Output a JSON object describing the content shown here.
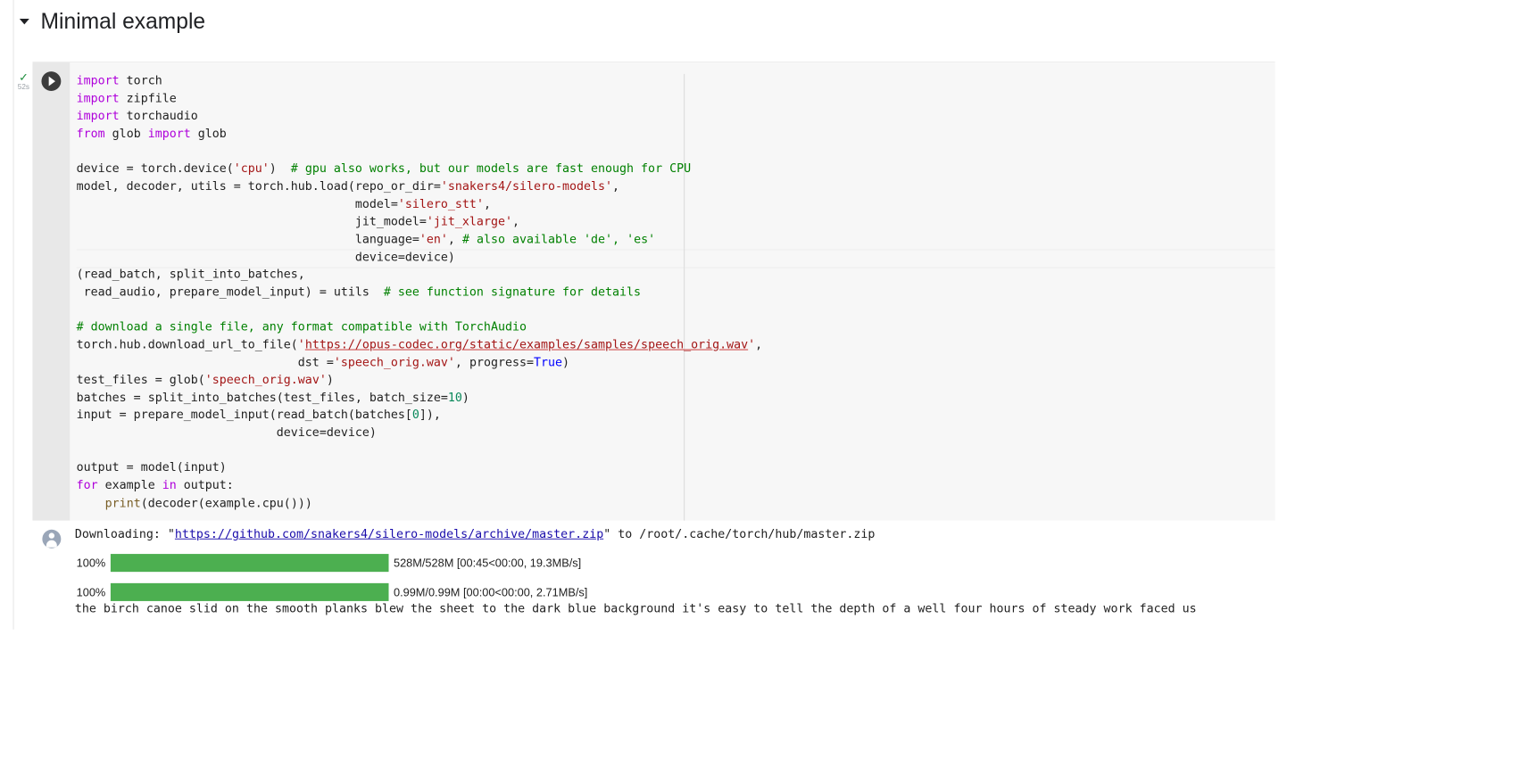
{
  "section": {
    "title": "Minimal example"
  },
  "cell": {
    "status_check": "✓",
    "exec_time": "52s",
    "code_lines": [
      "import torch",
      "import zipfile",
      "import torchaudio",
      "from glob import glob",
      "",
      "device = torch.device('cpu')  # gpu also works, but our models are fast enough for CPU",
      "model, decoder, utils = torch.hub.load(repo_or_dir='snakers4/silero-models',",
      "                                       model='silero_stt',",
      "                                       jit_model='jit_xlarge',",
      "                                       language='en', # also available 'de', 'es'",
      "                                       device=device)",
      "(read_batch, split_into_batches,",
      " read_audio, prepare_model_input) = utils  # see function signature for details",
      "",
      "# download a single file, any format compatible with TorchAudio",
      "torch.hub.download_url_to_file('https://opus-codec.org/static/examples/samples/speech_orig.wav',",
      "                               dst ='speech_orig.wav', progress=True)",
      "test_files = glob('speech_orig.wav')",
      "batches = split_into_batches(test_files, batch_size=10)",
      "input = prepare_model_input(read_batch(batches[0]),",
      "                            device=device)",
      "",
      "output = model(input)",
      "for example in output:",
      "    print(decoder(example.cpu()))"
    ]
  },
  "output": {
    "download_prefix": "Downloading: \"",
    "download_url": "https://github.com/snakers4/silero-models/archive/master.zip",
    "download_suffix": "\" to /root/.cache/torch/hub/master.zip",
    "progress": [
      {
        "percent_label": "100%",
        "fraction": 1.0,
        "stats": "528M/528M [00:45<00:00, 19.3MB/s]"
      },
      {
        "percent_label": "100%",
        "fraction": 1.0,
        "stats": "0.99M/0.99M [00:00<00:00, 2.71MB/s]"
      }
    ],
    "transcript": "the birch canoe slid on the smooth planks blew the sheet to the dark blue background it's easy to tell the depth of a well four hours of steady work faced us"
  },
  "colors": {
    "progress_fill": "#4caf50",
    "keyword": "#af00db",
    "string": "#a31515",
    "comment": "#008000",
    "number": "#09885a"
  },
  "icons": {
    "collapse": "caret-down-icon",
    "run": "play-icon",
    "success": "check-icon",
    "output": "user-avatar-icon"
  }
}
